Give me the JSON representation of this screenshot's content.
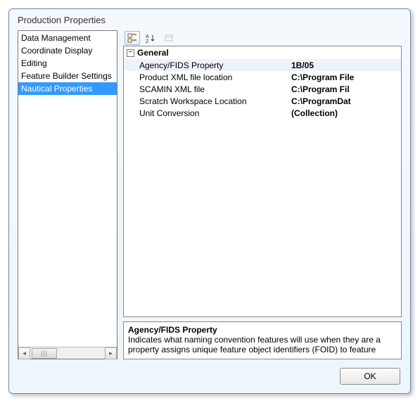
{
  "dialog": {
    "title": "Production Properties"
  },
  "nav": {
    "items": [
      {
        "label": "Data Management",
        "selected": false
      },
      {
        "label": "Coordinate Display",
        "selected": false
      },
      {
        "label": "Editing",
        "selected": false
      },
      {
        "label": "Feature Builder Settings",
        "selected": false
      },
      {
        "label": "Nautical Properties",
        "selected": true
      }
    ]
  },
  "toolbar": {
    "categorized_tip": "Categorized",
    "alphabetical_tip": "Alphabetical",
    "propertypages_tip": "Property Pages"
  },
  "grid": {
    "category": "General",
    "rows": [
      {
        "name": "Agency/FIDS Property",
        "value": "1B/05",
        "selected": true
      },
      {
        "name": "Product XML file location",
        "value": "C:\\Program File",
        "selected": false
      },
      {
        "name": "SCAMIN XML file",
        "value": "C:\\Program Fil",
        "selected": false
      },
      {
        "name": "Scratch Workspace Location",
        "value": "C:\\ProgramDat",
        "selected": false
      },
      {
        "name": "Unit Conversion",
        "value": "(Collection)",
        "selected": false
      }
    ]
  },
  "description": {
    "title": "Agency/FIDS Property",
    "body": "Indicates what naming convention features will use when they are a property assigns unique feature object identifiers (FOID) to feature"
  },
  "buttons": {
    "ok": "OK"
  }
}
